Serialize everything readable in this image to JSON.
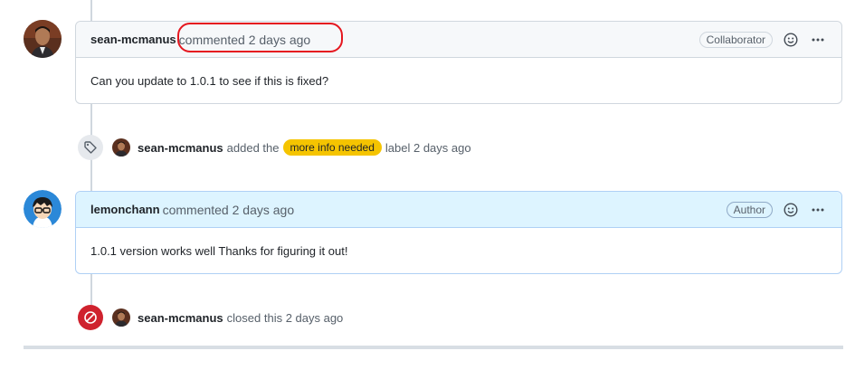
{
  "comments": [
    {
      "author": "sean-mcmanus",
      "meta": "commented 2 days ago",
      "role": "Collaborator",
      "body": "Can you update to 1.0.1 to see if this is fixed?"
    },
    {
      "author": "lemonchann",
      "meta": "commented 2 days ago",
      "role": "Author",
      "body": "1.0.1 version works well Thanks for figuring it out!"
    }
  ],
  "events": {
    "labeled": {
      "actor": "sean-mcmanus",
      "action": "added the",
      "label": "more info needed",
      "after": "label 2 days ago"
    },
    "closed": {
      "actor": "sean-mcmanus",
      "action": "closed this 2 days ago"
    }
  },
  "icons": {
    "reaction": "smiley-icon",
    "more": "kebab-horizontal-icon",
    "label_event": "tag-icon",
    "closed_event": "skip-icon"
  },
  "colors": {
    "label_bg": "#f5c400",
    "closed_badge": "#cf222e",
    "annotation": "#e5171f"
  }
}
